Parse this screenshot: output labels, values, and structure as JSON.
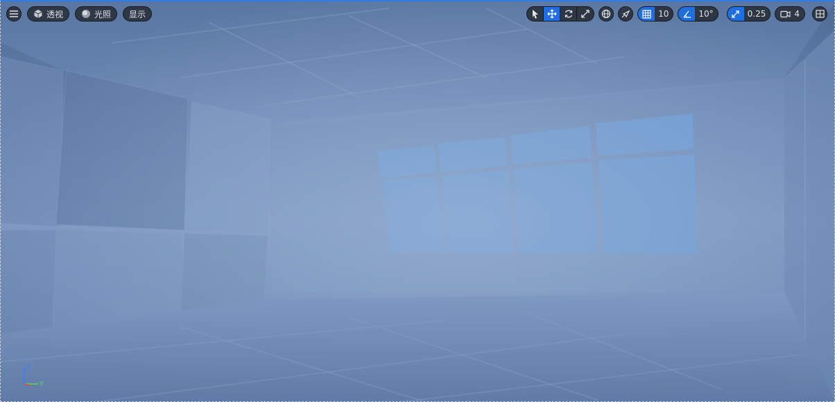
{
  "toolbar_left": {
    "menu_icon": "hamburger-menu-icon",
    "perspective_label": "透视",
    "lighting_label": "光照",
    "show_label": "显示"
  },
  "toolbar_right": {
    "transform_tools": [
      "select",
      "translate",
      "rotate",
      "scale"
    ],
    "active_tool": "translate",
    "grid_snap_value": "10",
    "rotation_snap_value": "10°",
    "scale_snap_value": "0.25",
    "camera_speed_value": "4"
  },
  "axis_gizmo": {
    "z": "Z",
    "y": "Y"
  },
  "colors": {
    "accent": "#1f6fe0",
    "axis_z": "#3d7bff",
    "axis_y": "#5fd35f",
    "axis_x": "#e0463a"
  }
}
